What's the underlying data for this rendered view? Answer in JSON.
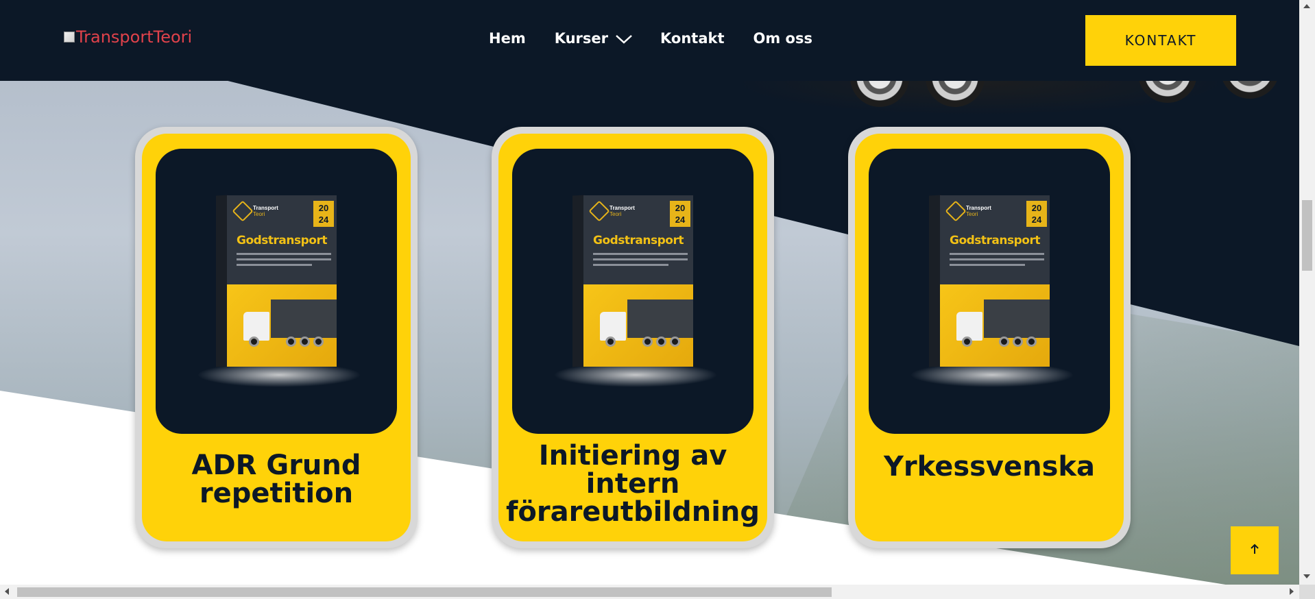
{
  "header": {
    "logo_alt": "TransportTeori",
    "nav": [
      {
        "label": "Hem"
      },
      {
        "label": "Kurser"
      },
      {
        "label": "Kontakt"
      },
      {
        "label": "Om oss"
      }
    ],
    "cta_label": "KONTAKT"
  },
  "courses": [
    {
      "title_lines": [
        "ADR Grund",
        "repetition"
      ],
      "box": {
        "brand": "Transport",
        "brand_sub": "Teori",
        "year_top": "20",
        "year_bottom": "24",
        "product": "Godstransport"
      }
    },
    {
      "title_lines": [
        "Initiering av",
        "intern",
        "förareutbildning"
      ],
      "box": {
        "brand": "Transport",
        "brand_sub": "Teori",
        "year_top": "20",
        "year_bottom": "24",
        "product": "Godstransport"
      }
    },
    {
      "title_lines": [
        "Yrkessvenska"
      ],
      "box": {
        "brand": "Transport",
        "brand_sub": "Teori",
        "year_top": "20",
        "year_bottom": "24",
        "product": "Godstransport"
      }
    }
  ],
  "scroll_to_top_icon": "arrow-up-icon",
  "colors": {
    "navy": "#0c1827",
    "yellow": "#ffd209",
    "logo_red": "#e0424b"
  }
}
